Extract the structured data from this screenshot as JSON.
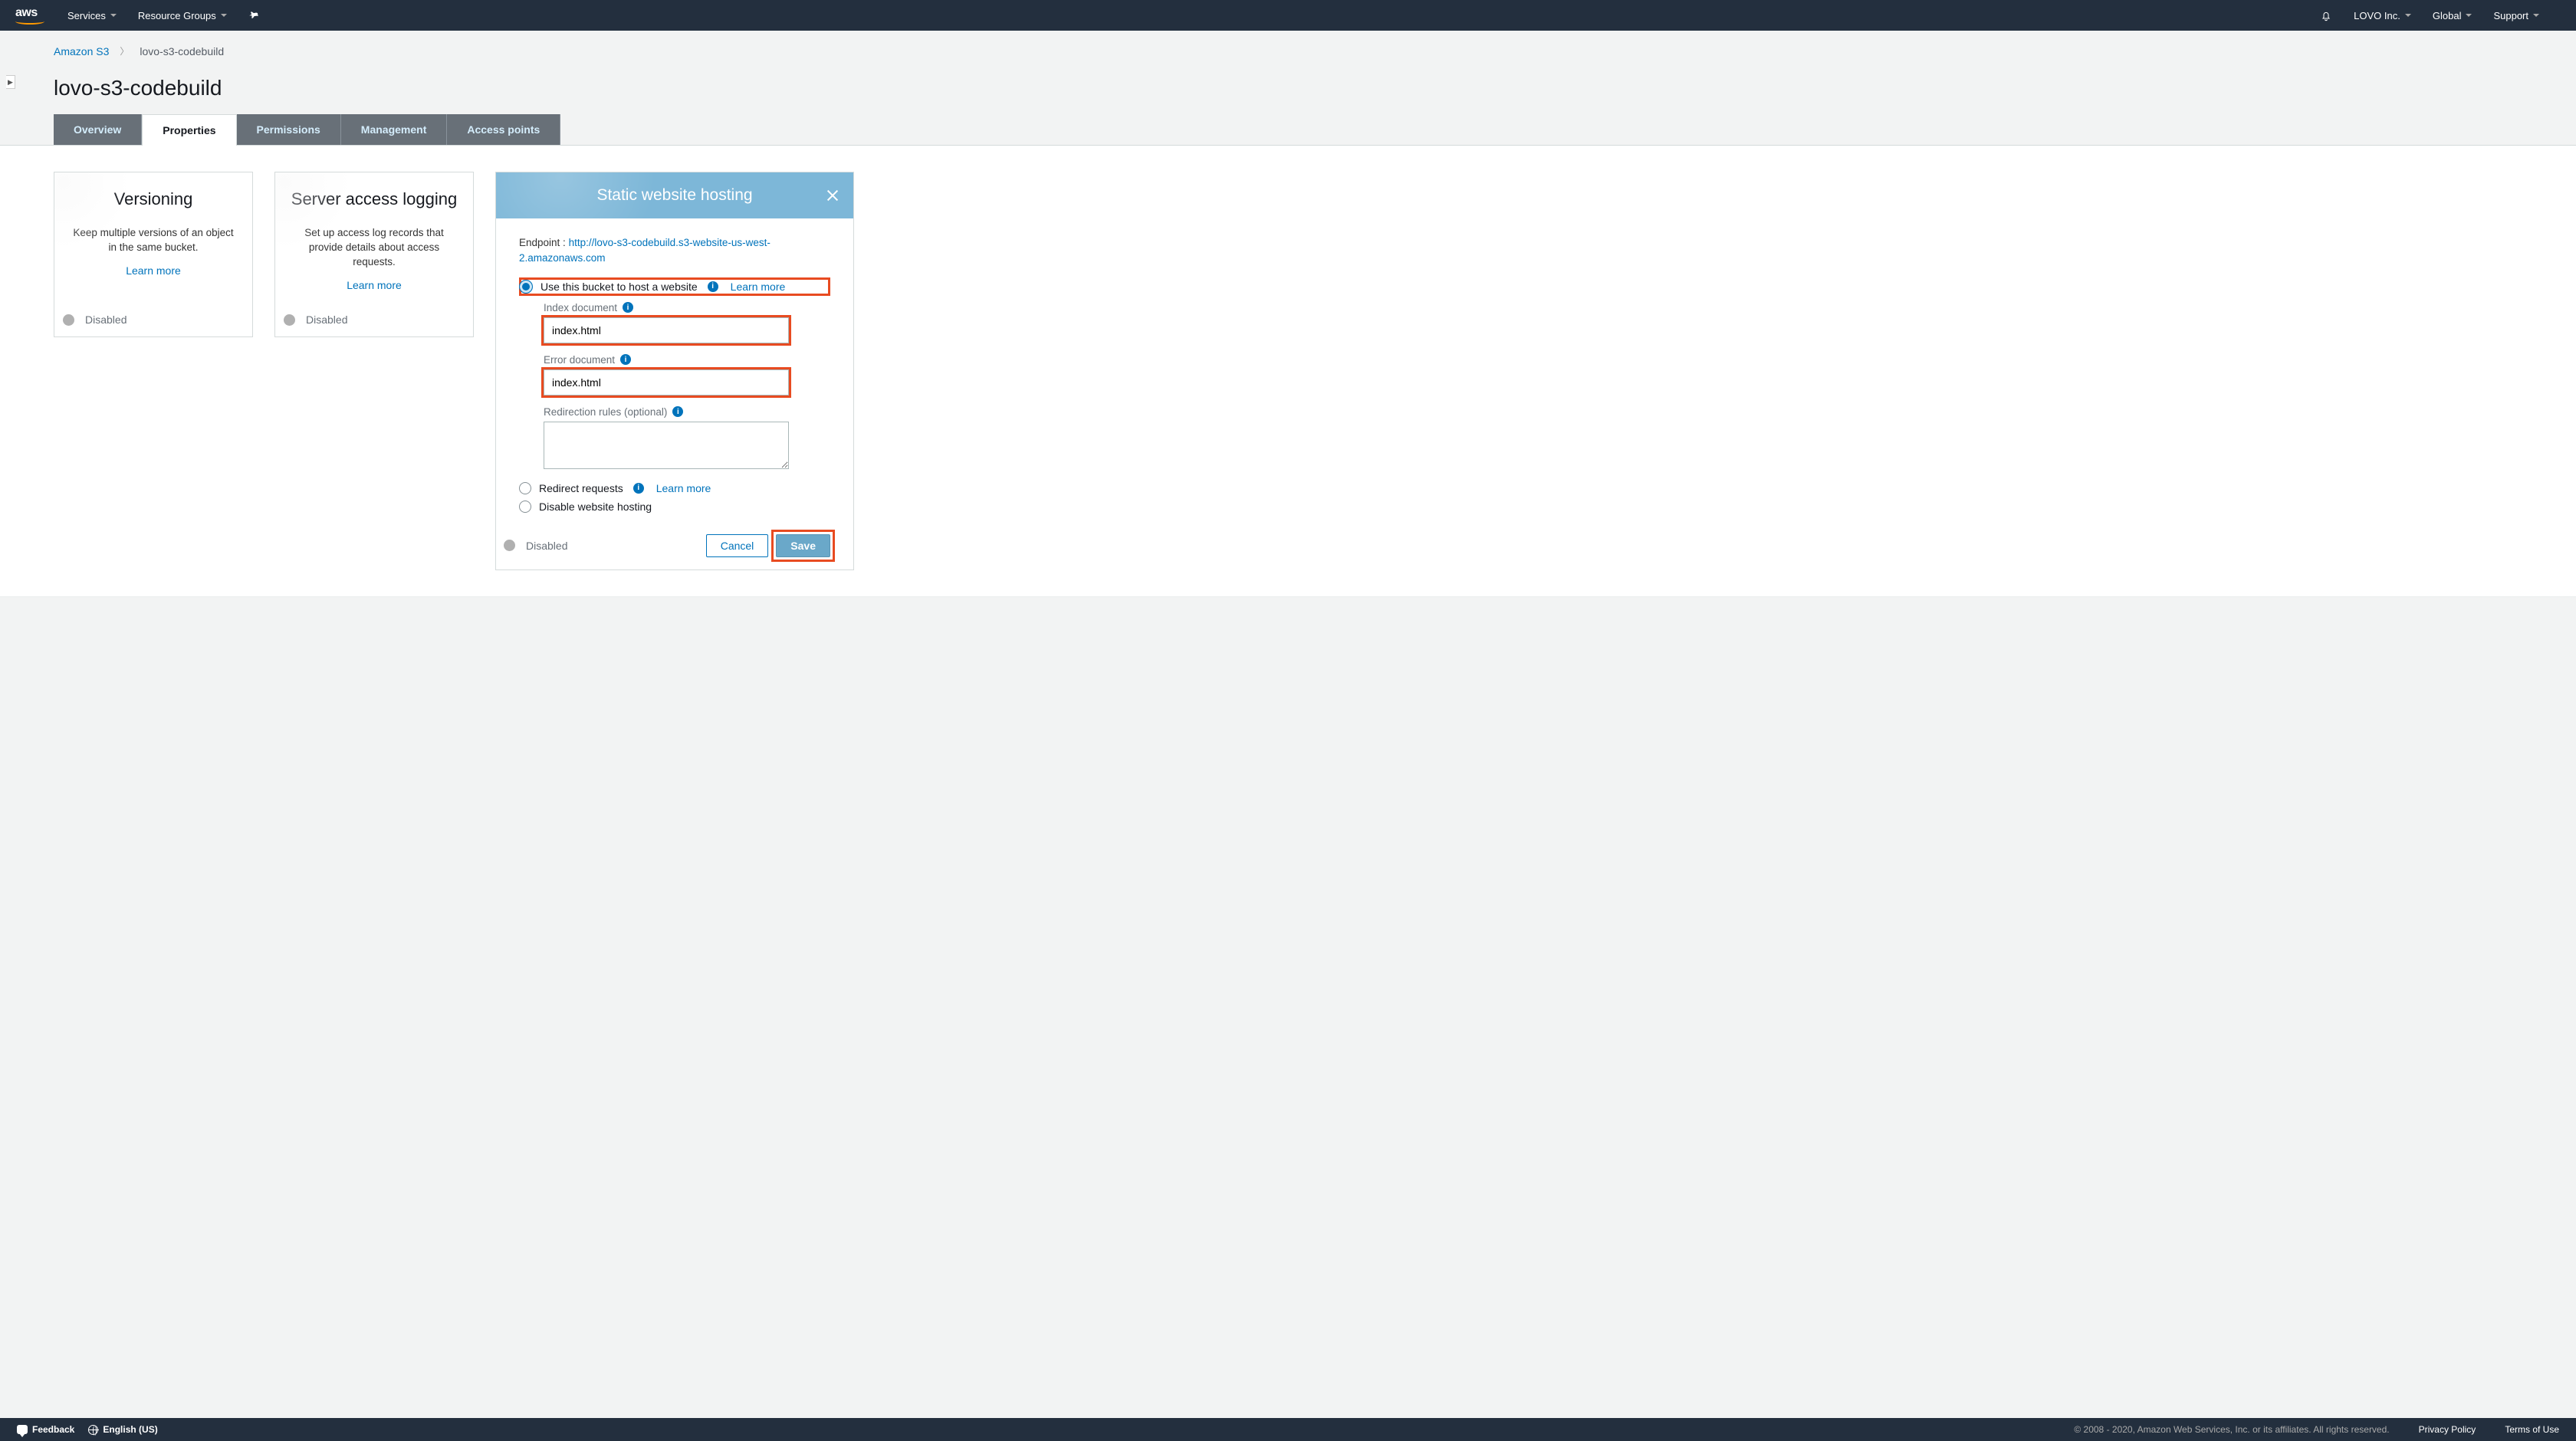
{
  "topnav": {
    "logo": "aws",
    "services": "Services",
    "resource_groups": "Resource Groups",
    "account": "LOVO Inc.",
    "region": "Global",
    "support": "Support"
  },
  "breadcrumb": {
    "root": "Amazon S3",
    "current": "lovo-s3-codebuild"
  },
  "title": "lovo-s3-codebuild",
  "tabs": {
    "overview": "Overview",
    "properties": "Properties",
    "permissions": "Permissions",
    "management": "Management",
    "access_points": "Access points"
  },
  "cards": {
    "versioning": {
      "title": "Versioning",
      "desc": "Keep multiple versions of an object in the same bucket.",
      "learn_more": "Learn more",
      "status": "Disabled"
    },
    "logging": {
      "title": "Server access logging",
      "desc": "Set up access log records that provide details about access requests.",
      "learn_more": "Learn more",
      "status": "Disabled"
    }
  },
  "hosting": {
    "title": "Static website hosting",
    "endpoint_label": "Endpoint :",
    "endpoint_url": "http://lovo-s3-codebuild.s3-website-us-west-2.amazonaws.com",
    "opt_host": "Use this bucket to host a website",
    "opt_host_learn": "Learn more",
    "index_label": "Index document",
    "index_value": "index.html",
    "error_label": "Error document",
    "error_value": "index.html",
    "redir_rules_label": "Redirection rules (optional)",
    "opt_redirect": "Redirect requests",
    "opt_redirect_learn": "Learn more",
    "opt_disable": "Disable website hosting",
    "status": "Disabled",
    "cancel": "Cancel",
    "save": "Save"
  },
  "footer": {
    "feedback": "Feedback",
    "language": "English (US)",
    "copyright": "© 2008 - 2020, Amazon Web Services, Inc. or its affiliates. All rights reserved.",
    "privacy": "Privacy Policy",
    "terms": "Terms of Use"
  }
}
